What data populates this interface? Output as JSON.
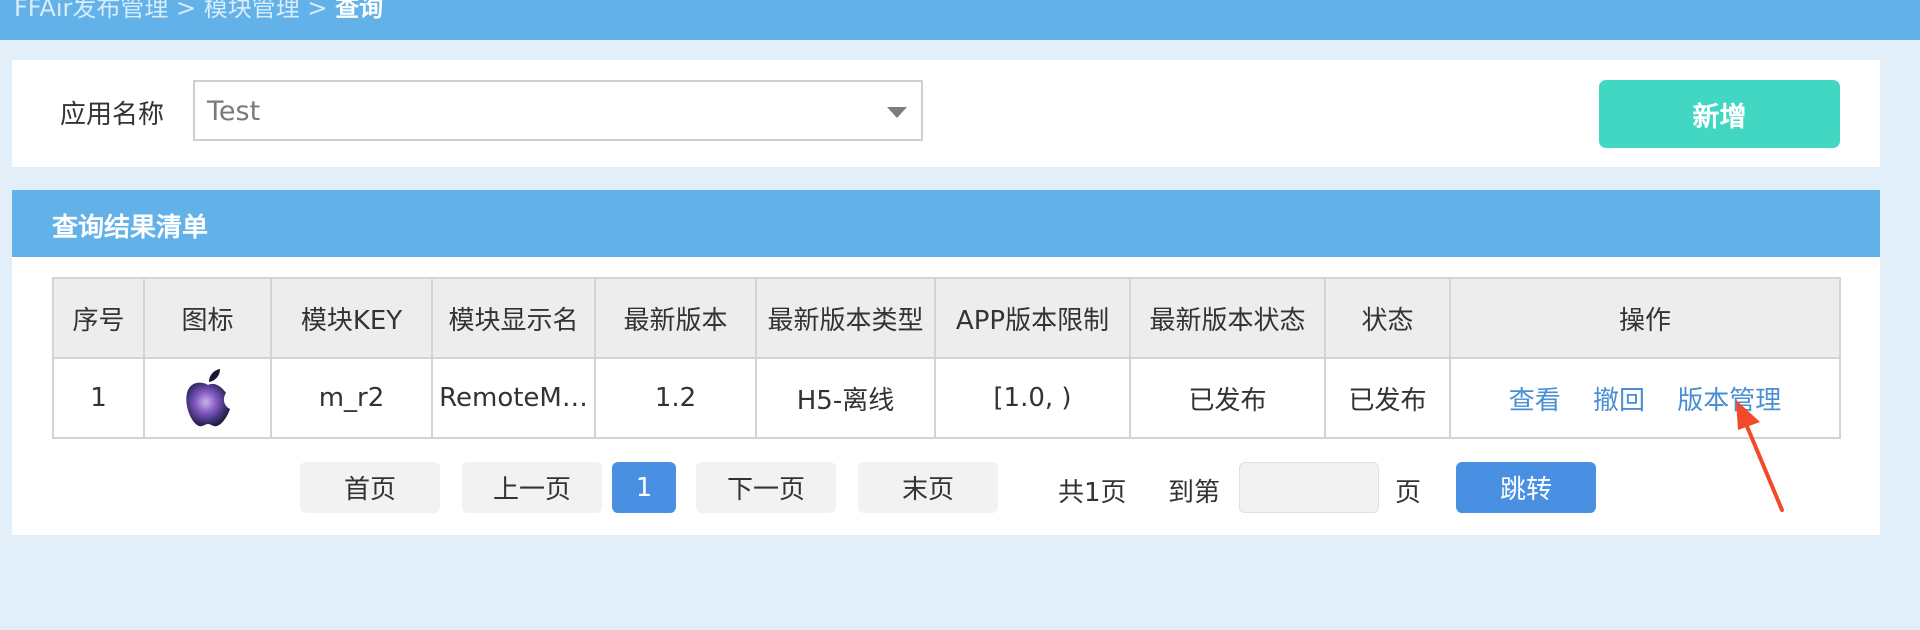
{
  "breadcrumb": {
    "path": "FFAir发布管理 > 模块管理 > ",
    "current": "查询"
  },
  "search": {
    "label": "应用名称",
    "selected_value": "Test",
    "add_button": "新增"
  },
  "results": {
    "title": "查询结果清单",
    "columns": [
      "序号",
      "图标",
      "模块KEY",
      "模块显示名",
      "最新版本",
      "最新版本类型",
      "APP版本限制",
      "最新版本状态",
      "状态",
      "操作"
    ],
    "rows": [
      {
        "index": "1",
        "icon": "apple-logo-icon",
        "key": "m_r2",
        "display_name": "RemoteM…",
        "version": "1.2",
        "version_type": "H5-离线",
        "app_limit": "[1.0, )",
        "version_status": "已发布",
        "status": "已发布",
        "actions": {
          "view": "查看",
          "revoke": "撤回",
          "manage": "版本管理"
        }
      }
    ]
  },
  "pagination": {
    "first": "首页",
    "prev": "上一页",
    "current": "1",
    "next": "下一页",
    "last": "末页",
    "total": "共1页",
    "goto_label": "到第",
    "page_unit": "页",
    "jump": "跳转"
  },
  "colors": {
    "header_blue": "#62b2e9",
    "teal_button": "#41d7c2",
    "primary_blue": "#4a90e2",
    "link_blue": "#4a8fd3",
    "annotation_red": "#f04a2a"
  }
}
